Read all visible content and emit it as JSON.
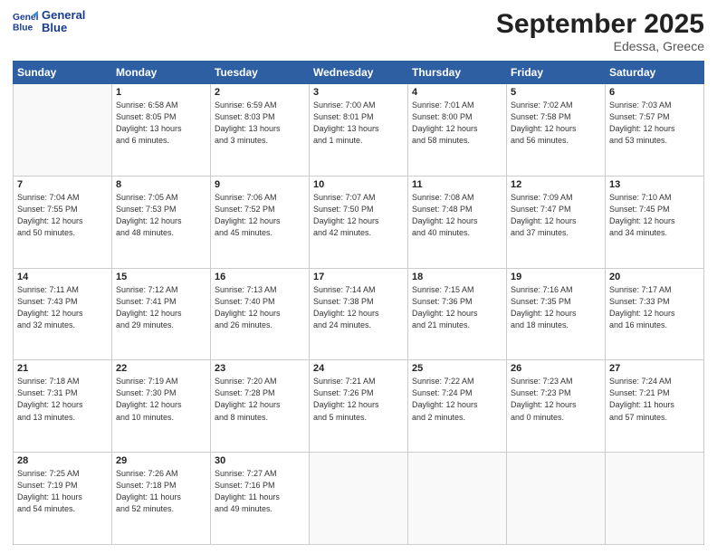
{
  "logo": {
    "line1": "General",
    "line2": "Blue"
  },
  "title": "September 2025",
  "subtitle": "Edessa, Greece",
  "days_of_week": [
    "Sunday",
    "Monday",
    "Tuesday",
    "Wednesday",
    "Thursday",
    "Friday",
    "Saturday"
  ],
  "weeks": [
    [
      {
        "day": null,
        "info": null
      },
      {
        "day": "1",
        "info": "Sunrise: 6:58 AM\nSunset: 8:05 PM\nDaylight: 13 hours\nand 6 minutes."
      },
      {
        "day": "2",
        "info": "Sunrise: 6:59 AM\nSunset: 8:03 PM\nDaylight: 13 hours\nand 3 minutes."
      },
      {
        "day": "3",
        "info": "Sunrise: 7:00 AM\nSunset: 8:01 PM\nDaylight: 13 hours\nand 1 minute."
      },
      {
        "day": "4",
        "info": "Sunrise: 7:01 AM\nSunset: 8:00 PM\nDaylight: 12 hours\nand 58 minutes."
      },
      {
        "day": "5",
        "info": "Sunrise: 7:02 AM\nSunset: 7:58 PM\nDaylight: 12 hours\nand 56 minutes."
      },
      {
        "day": "6",
        "info": "Sunrise: 7:03 AM\nSunset: 7:57 PM\nDaylight: 12 hours\nand 53 minutes."
      }
    ],
    [
      {
        "day": "7",
        "info": "Sunrise: 7:04 AM\nSunset: 7:55 PM\nDaylight: 12 hours\nand 50 minutes."
      },
      {
        "day": "8",
        "info": "Sunrise: 7:05 AM\nSunset: 7:53 PM\nDaylight: 12 hours\nand 48 minutes."
      },
      {
        "day": "9",
        "info": "Sunrise: 7:06 AM\nSunset: 7:52 PM\nDaylight: 12 hours\nand 45 minutes."
      },
      {
        "day": "10",
        "info": "Sunrise: 7:07 AM\nSunset: 7:50 PM\nDaylight: 12 hours\nand 42 minutes."
      },
      {
        "day": "11",
        "info": "Sunrise: 7:08 AM\nSunset: 7:48 PM\nDaylight: 12 hours\nand 40 minutes."
      },
      {
        "day": "12",
        "info": "Sunrise: 7:09 AM\nSunset: 7:47 PM\nDaylight: 12 hours\nand 37 minutes."
      },
      {
        "day": "13",
        "info": "Sunrise: 7:10 AM\nSunset: 7:45 PM\nDaylight: 12 hours\nand 34 minutes."
      }
    ],
    [
      {
        "day": "14",
        "info": "Sunrise: 7:11 AM\nSunset: 7:43 PM\nDaylight: 12 hours\nand 32 minutes."
      },
      {
        "day": "15",
        "info": "Sunrise: 7:12 AM\nSunset: 7:41 PM\nDaylight: 12 hours\nand 29 minutes."
      },
      {
        "day": "16",
        "info": "Sunrise: 7:13 AM\nSunset: 7:40 PM\nDaylight: 12 hours\nand 26 minutes."
      },
      {
        "day": "17",
        "info": "Sunrise: 7:14 AM\nSunset: 7:38 PM\nDaylight: 12 hours\nand 24 minutes."
      },
      {
        "day": "18",
        "info": "Sunrise: 7:15 AM\nSunset: 7:36 PM\nDaylight: 12 hours\nand 21 minutes."
      },
      {
        "day": "19",
        "info": "Sunrise: 7:16 AM\nSunset: 7:35 PM\nDaylight: 12 hours\nand 18 minutes."
      },
      {
        "day": "20",
        "info": "Sunrise: 7:17 AM\nSunset: 7:33 PM\nDaylight: 12 hours\nand 16 minutes."
      }
    ],
    [
      {
        "day": "21",
        "info": "Sunrise: 7:18 AM\nSunset: 7:31 PM\nDaylight: 12 hours\nand 13 minutes."
      },
      {
        "day": "22",
        "info": "Sunrise: 7:19 AM\nSunset: 7:30 PM\nDaylight: 12 hours\nand 10 minutes."
      },
      {
        "day": "23",
        "info": "Sunrise: 7:20 AM\nSunset: 7:28 PM\nDaylight: 12 hours\nand 8 minutes."
      },
      {
        "day": "24",
        "info": "Sunrise: 7:21 AM\nSunset: 7:26 PM\nDaylight: 12 hours\nand 5 minutes."
      },
      {
        "day": "25",
        "info": "Sunrise: 7:22 AM\nSunset: 7:24 PM\nDaylight: 12 hours\nand 2 minutes."
      },
      {
        "day": "26",
        "info": "Sunrise: 7:23 AM\nSunset: 7:23 PM\nDaylight: 12 hours\nand 0 minutes."
      },
      {
        "day": "27",
        "info": "Sunrise: 7:24 AM\nSunset: 7:21 PM\nDaylight: 11 hours\nand 57 minutes."
      }
    ],
    [
      {
        "day": "28",
        "info": "Sunrise: 7:25 AM\nSunset: 7:19 PM\nDaylight: 11 hours\nand 54 minutes."
      },
      {
        "day": "29",
        "info": "Sunrise: 7:26 AM\nSunset: 7:18 PM\nDaylight: 11 hours\nand 52 minutes."
      },
      {
        "day": "30",
        "info": "Sunrise: 7:27 AM\nSunset: 7:16 PM\nDaylight: 11 hours\nand 49 minutes."
      },
      {
        "day": null,
        "info": null
      },
      {
        "day": null,
        "info": null
      },
      {
        "day": null,
        "info": null
      },
      {
        "day": null,
        "info": null
      }
    ]
  ]
}
